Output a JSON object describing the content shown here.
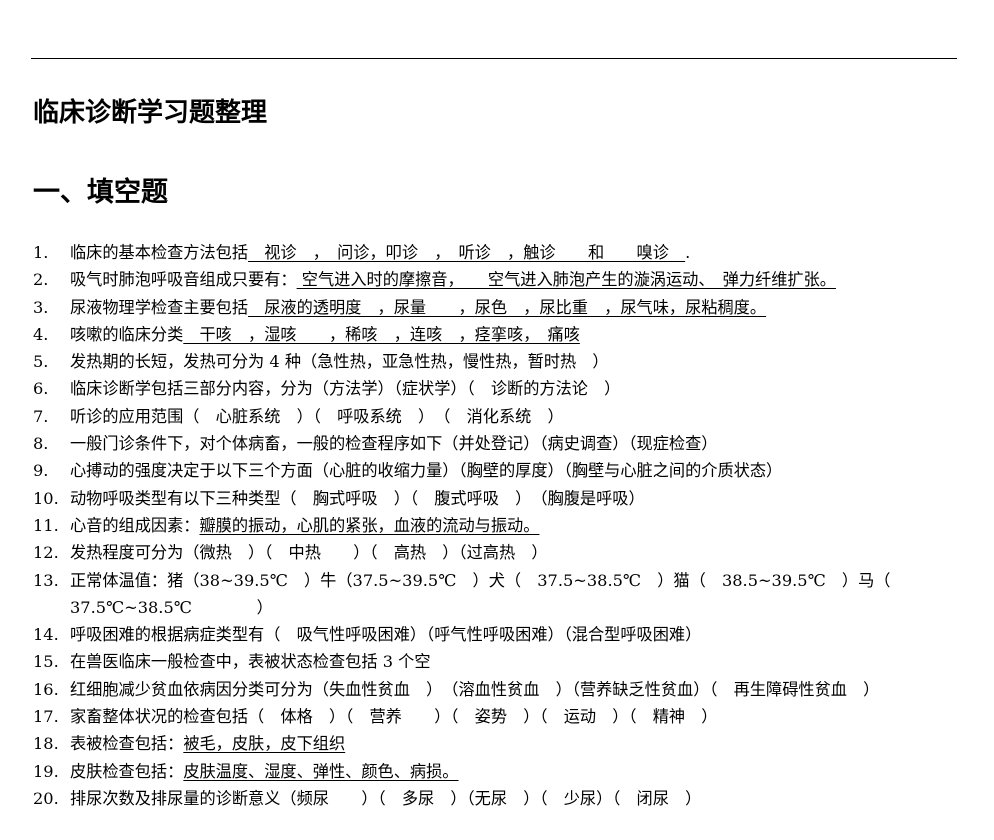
{
  "document": {
    "title": "临床诊断学习题整理",
    "section_title": "一、填空题",
    "items": [
      {
        "num": "1.",
        "parts": [
          {
            "text": "临床的基本检查方法包括"
          },
          {
            "text": "　视诊　，　问诊，叩诊　，　听诊　，触诊　　和　　嗅诊　",
            "u": true
          },
          {
            "text": "."
          }
        ]
      },
      {
        "num": "2.",
        "parts": [
          {
            "text": "吸气时肺泡呼吸音组成只要有："
          },
          {
            "text": " 空气进入时的摩擦音，　　空气进入肺泡产生的漩涡运动、　弹力纤维扩张。",
            "u": true
          }
        ]
      },
      {
        "num": "3.",
        "parts": [
          {
            "text": "尿液物理学检查主要包括"
          },
          {
            "text": "　尿液的透明度　，尿量　　，尿色　，尿比重　，尿气味，尿粘稠度。",
            "u": true
          }
        ]
      },
      {
        "num": "4.",
        "parts": [
          {
            "text": "咳嗽的临床分类"
          },
          {
            "text": "　干咳　，湿咳　　，稀咳　，连咳　，痉挛咳，　痛咳",
            "u": true
          }
        ]
      },
      {
        "num": "5.",
        "parts": [
          {
            "text": "发热期的长短，发热可分为 4 种（急性热，亚急性热，慢性热，暂时热　）"
          }
        ]
      },
      {
        "num": "6.",
        "parts": [
          {
            "text": "临床诊断学包括三部分内容，分为（方法学）（症状学）（　诊断的方法论　）"
          }
        ]
      },
      {
        "num": "7.",
        "parts": [
          {
            "text": "听诊的应用范围（　心脏系统　）（　呼吸系统　）　（　消化系统　）"
          }
        ]
      },
      {
        "num": "8.",
        "parts": [
          {
            "text": "一般门诊条件下，对个体病畜，一般的检查程序如下（并处登记）（病史调查）（现症检查）"
          }
        ]
      },
      {
        "num": "9.",
        "parts": [
          {
            "text": "心搏动的强度决定于以下三个方面（心脏的收缩力量）（胸壁的厚度）（胸壁与心脏之间的介质状态）"
          }
        ]
      },
      {
        "num": "10.",
        "parts": [
          {
            "text": "动物呼吸类型有以下三种类型（　胸式呼吸　）（　腹式呼吸　）　（胸腹是呼吸）"
          }
        ]
      },
      {
        "num": "11.",
        "parts": [
          {
            "text": "心音的组成因素："
          },
          {
            "text": "瓣膜的振动，心肌的紧张，血液的流动与振动。",
            "u": true
          }
        ]
      },
      {
        "num": "12.",
        "parts": [
          {
            "text": "发热程度可分为（微热　）（　中热　　）（　高热　）（过高热　）"
          }
        ]
      },
      {
        "num": "13.",
        "wrap": true,
        "parts": [
          {
            "text": "正常体温值：猪（38~39.5℃　）牛（37.5~39.5℃　）犬（　37.5~38.5℃　）猫（　38.5~39.5℃　）马（　37.5℃~38.5℃　　　　）"
          }
        ]
      },
      {
        "num": "14.",
        "parts": [
          {
            "text": "呼吸困难的根据病症类型有（　吸气性呼吸困难）（呼气性呼吸困难）（混合型呼吸困难）"
          }
        ]
      },
      {
        "num": "15.",
        "parts": [
          {
            "text": "在兽医临床一般检查中，表被状态检查包括 3 个空"
          }
        ]
      },
      {
        "num": "16.",
        "wrap": true,
        "parts": [
          {
            "text": "红细胞减少贫血依病因分类可分为（失血性贫血　）　（溶血性贫血　）（营养缺乏性贫血）（　再生障碍性贫血　）"
          }
        ]
      },
      {
        "num": "17.",
        "parts": [
          {
            "text": "家畜整体状况的检查包括（　体格　）（　营养　　）（　姿势　）（　运动　）（　精神　）"
          }
        ]
      },
      {
        "num": "18.",
        "parts": [
          {
            "text": "表被检查包括："
          },
          {
            "text": "被毛，皮肤，皮下组织",
            "u": true
          }
        ]
      },
      {
        "num": "19.",
        "parts": [
          {
            "text": "皮肤检查包括："
          },
          {
            "text": "皮肤温度、湿度、弹性、颜色、病损。",
            "u": true
          }
        ]
      },
      {
        "num": "20.",
        "parts": [
          {
            "text": "排尿次数及排尿量的诊断意义（频尿　　）（　多尿　）（无尿　）（　少尿）（　闭尿　）"
          }
        ]
      }
    ]
  }
}
